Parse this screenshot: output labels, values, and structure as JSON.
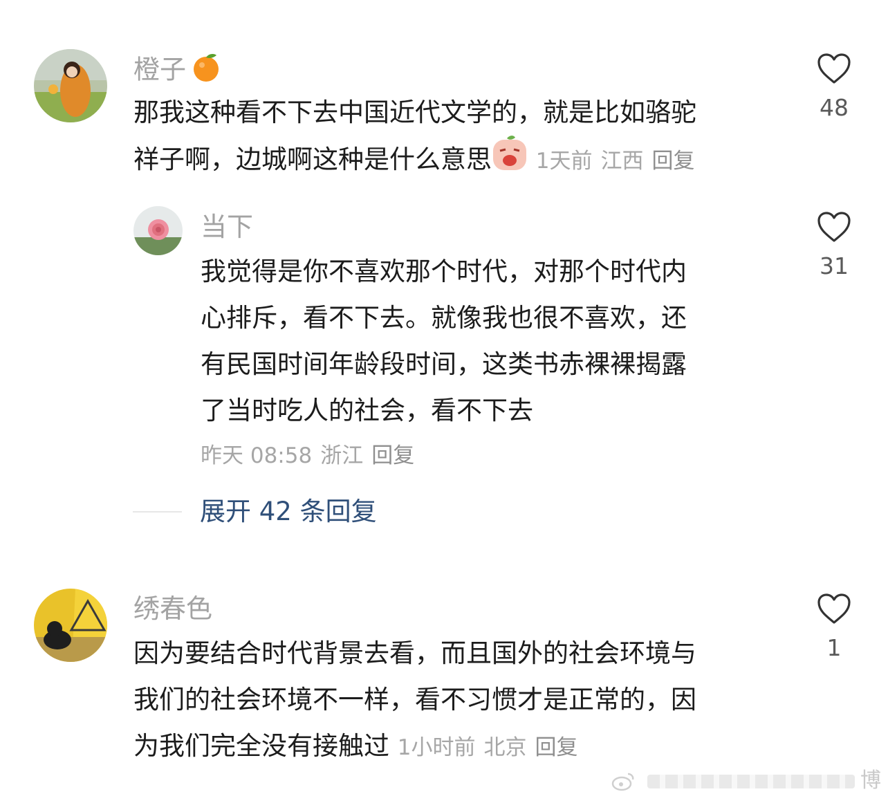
{
  "comments": [
    {
      "username": "橙子",
      "username_emoji": "orange-emoji",
      "text_lines": [
        "那我这种看不下去中国近代文学的，就是比如骆驼",
        "祥子啊，边城啊这种是什么意思"
      ],
      "text_emoji": "crying-face-emoji",
      "time": "1天前",
      "location": "江西",
      "reply_label": "回复",
      "likes": "48"
    },
    {
      "username": "当下",
      "text_lines": [
        "我觉得是你不喜欢那个时代，对那个时代内",
        "心排斥，看不下去。就像我也很不喜欢，还",
        "有民国时间年龄段时间，这类书赤裸裸揭露",
        "了当时吃人的社会，看不下去"
      ],
      "time": "昨天 08:58",
      "location": "浙江",
      "reply_label": "回复",
      "likes": "31"
    },
    {
      "username": "绣春色",
      "text_lines": [
        "因为要结合时代背景去看，而且国外的社会环境与",
        "我们的社会环境不一样，看不习惯才是正常的，因",
        "为我们完全没有接触过"
      ],
      "time": "1小时前",
      "location": "北京",
      "reply_label": "回复",
      "likes": "1"
    }
  ],
  "expand_replies": "展开 42 条回复",
  "watermark": "博",
  "icons": {
    "like": "heart-outline-icon",
    "watermark_logo": "weibo-logo-icon"
  },
  "colors": {
    "username": "#a3a3a3",
    "text": "#1c1c1c",
    "meta": "#a6a6a6",
    "expand_link": "#2f4f79",
    "like_icon": "#333333"
  }
}
